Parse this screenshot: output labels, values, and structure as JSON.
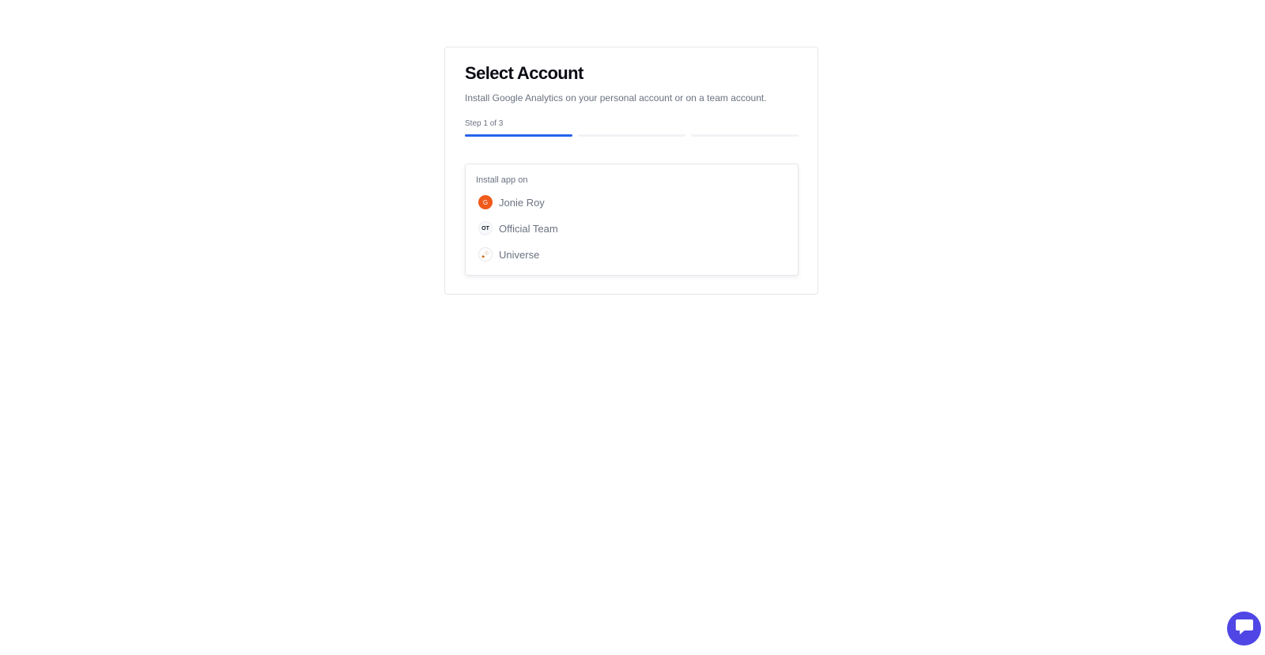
{
  "card": {
    "title": "Select Account",
    "subtitle": "Install Google Analytics on your personal account or on a team account.",
    "step_label": "Step 1 of 3",
    "progress": {
      "current_step": 1,
      "total_steps": 3
    }
  },
  "accounts_panel": {
    "label": "Install app on",
    "accounts": [
      {
        "name": "Jonie Roy",
        "avatar_text": "G",
        "avatar_color": "#f05a1a"
      },
      {
        "name": "Official Team",
        "avatar_text": "OT"
      },
      {
        "name": "Universe",
        "avatar_icon": "universe-logo-icon"
      }
    ]
  },
  "chat_widget": {
    "icon": "chat-bubble-icon",
    "color": "#4f46e5"
  },
  "colors": {
    "accent": "#2563eb",
    "muted_text": "#6b7280"
  }
}
